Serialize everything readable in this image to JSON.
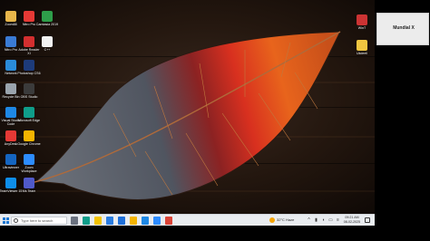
{
  "desktop_icons": [
    {
      "label": "Zoom88",
      "icon": "folder-icon",
      "color": "#e8b64a"
    },
    {
      "label": "Nitro Pro",
      "icon": "nitro-icon",
      "color": "#e53935"
    },
    {
      "label": "Camtasia 2019",
      "icon": "camtasia-icon",
      "color": "#2e9e4a"
    },
    {
      "label": "Nitro Pro",
      "icon": "nitro-icon",
      "color": "#3a7bd5"
    },
    {
      "label": "Adobe Reader XI",
      "icon": "pdf-icon",
      "color": "#d32f2f"
    },
    {
      "label": "C++",
      "icon": "file-icon",
      "color": "#f2f2f2"
    },
    {
      "label": "Network",
      "icon": "network-icon",
      "color": "#2a8bd8"
    },
    {
      "label": "Photoshop CS6",
      "icon": "photoshop-icon",
      "color": "#1d3b7a"
    },
    {
      "label": "Recycle Bin",
      "icon": "recycle-bin-icon",
      "color": "#9aa4ad"
    },
    {
      "label": "OBS Studio",
      "icon": "obs-icon",
      "color": "#3b3b3b"
    },
    {
      "label": "Visual Studio Code",
      "icon": "vscode-icon",
      "color": "#1e88e5"
    },
    {
      "label": "Microsoft Edge",
      "icon": "edge-icon",
      "color": "#0f9d8a"
    },
    {
      "label": "AnyDesk",
      "icon": "anydesk-icon",
      "color": "#e53935"
    },
    {
      "label": "Google Chrome",
      "icon": "chrome-icon",
      "color": "#f4b400"
    },
    {
      "label": "Ultraviewer",
      "icon": "ultraviewer-icon",
      "color": "#1565c0"
    },
    {
      "label": "Zoom Workplace",
      "icon": "zoom-icon",
      "color": "#2d8cff"
    },
    {
      "label": "TeamViewer 15",
      "icon": "teamviewer-icon",
      "color": "#0e8ee9"
    },
    {
      "label": "Ms Team",
      "icon": "teams-icon",
      "color": "#5059c9"
    }
  ],
  "right_icons": [
    {
      "label": "WinT",
      "icon": "app-icon",
      "color": "#cc3333"
    },
    {
      "label": "Ukdeell",
      "icon": "file-icon",
      "color": "#f0c640"
    }
  ],
  "right_card": {
    "label": "Mundial X"
  },
  "taskbar": {
    "search_placeholder": "Type here to search",
    "weather": "32°C  Haze",
    "clock_time": "09:21 AM",
    "clock_date": "08-02-2025",
    "pinned_apps": [
      {
        "icon": "task-view-icon",
        "color": "#6b7280"
      },
      {
        "icon": "edge-icon",
        "color": "#0f9d8a"
      },
      {
        "icon": "file-explorer-icon",
        "color": "#f2c200"
      },
      {
        "icon": "store-icon",
        "color": "#2a7de1"
      },
      {
        "icon": "mail-icon",
        "color": "#1e6fd9"
      },
      {
        "icon": "chrome-icon",
        "color": "#f4b400"
      },
      {
        "icon": "vscode-icon",
        "color": "#1e88e5"
      },
      {
        "icon": "zoom-icon",
        "color": "#2d8cff"
      },
      {
        "icon": "chrome-icon",
        "color": "#db4437"
      }
    ]
  }
}
